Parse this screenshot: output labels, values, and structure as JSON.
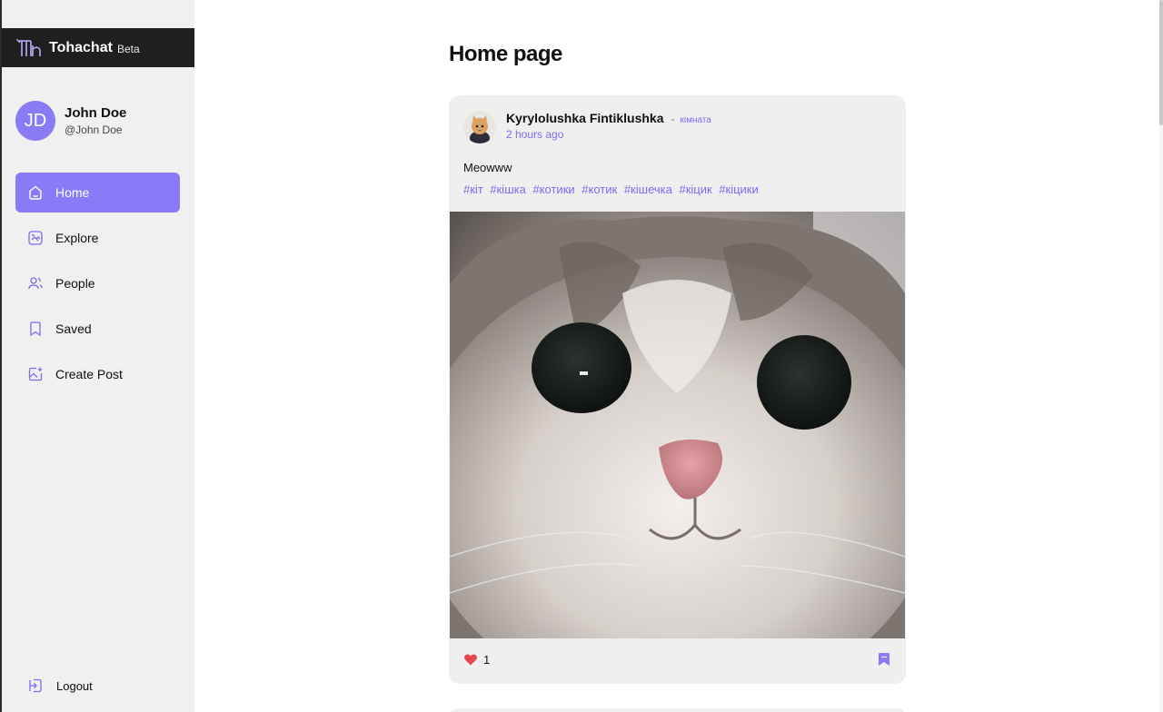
{
  "brand": {
    "name": "Tohachat",
    "tag": "Beta"
  },
  "user": {
    "initials": "JD",
    "name": "John Doe",
    "handle": "@John Doe"
  },
  "nav": {
    "items": [
      {
        "label": "Home",
        "icon": "home-icon",
        "active": true
      },
      {
        "label": "Explore",
        "icon": "explore-icon",
        "active": false
      },
      {
        "label": "People",
        "icon": "people-icon",
        "active": false
      },
      {
        "label": "Saved",
        "icon": "bookmark-icon",
        "active": false
      },
      {
        "label": "Create Post",
        "icon": "create-post-icon",
        "active": false
      }
    ],
    "logout": "Logout"
  },
  "main": {
    "title": "Home page"
  },
  "post": {
    "author": "Kyrylolushka Fintiklushka",
    "separator": "-",
    "room": "кімната",
    "time": "2 hours ago",
    "text": "Meowww",
    "tags": [
      "#кіт",
      "#кішка",
      "#котики",
      "#котик",
      "#кішечка",
      "#кіцик",
      "#кіцики"
    ],
    "likes": "1"
  },
  "colors": {
    "accent": "#8a7af8",
    "link": "#7b6cf0",
    "sidebar_bg": "#f0f0f0",
    "brand_bg": "#1f1f1f",
    "card_bg": "#efefef",
    "like": "#e5484d"
  }
}
